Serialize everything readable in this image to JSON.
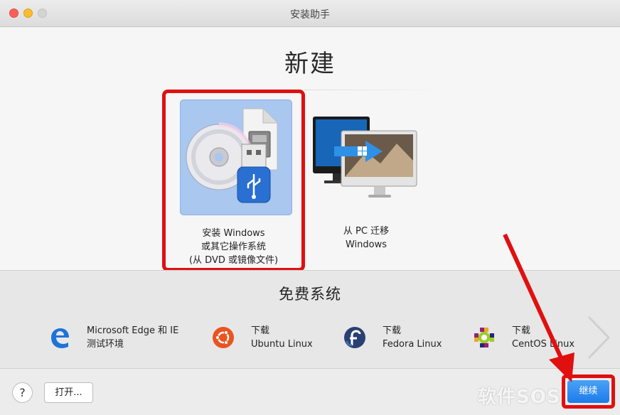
{
  "window": {
    "title": "安装助手"
  },
  "main": {
    "heading": "新建",
    "options": [
      {
        "line1": "安装 Windows",
        "line2": "或其它操作系统",
        "line3": "(从 DVD 或镜像文件)"
      },
      {
        "line1": "从 PC 迁移",
        "line2": "Windows"
      }
    ]
  },
  "free": {
    "heading": "免费系统",
    "items": [
      {
        "line1": "Microsoft Edge 和 IE",
        "line2": "测试环境",
        "icon": "edge-icon"
      },
      {
        "line1": "下载",
        "line2": "Ubuntu Linux",
        "icon": "ubuntu-icon"
      },
      {
        "line1": "下载",
        "line2": "Fedora Linux",
        "icon": "fedora-icon"
      },
      {
        "line1": "下载",
        "line2": "CentOS Linux",
        "icon": "centos-icon"
      }
    ]
  },
  "bottom": {
    "help_label": "?",
    "open_label": "打开...",
    "continue_label": "继续"
  },
  "watermark": "软件SOS",
  "colors": {
    "highlight": "#e01010",
    "accent": "#1d7bea",
    "tile": "#a9c7ef"
  }
}
